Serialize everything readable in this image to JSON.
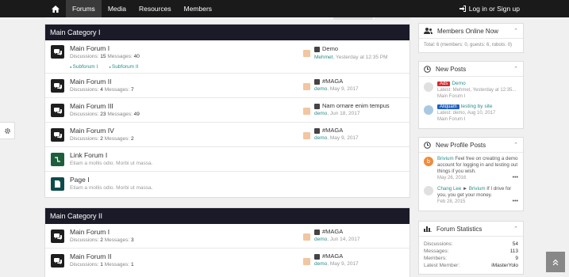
{
  "nav": {
    "items": [
      "Forums",
      "Media",
      "Resources",
      "Members"
    ],
    "login_label": "Log in or Sign up"
  },
  "categories": [
    {
      "title": "Main Category I",
      "forums": [
        {
          "title": "Main Forum I",
          "stats": {
            "disc_label": "Discussions:",
            "disc": "15",
            "msg_label": "Messages:",
            "msg": "40"
          },
          "subforums": [
            "Subforum I",
            "Subforum II"
          ],
          "last": {
            "title": "Demo",
            "user": "Mehmet",
            "date": "Yesterday at 12:35 PM"
          }
        },
        {
          "title": "Main Forum II",
          "stats": {
            "disc_label": "Discussions:",
            "disc": "4",
            "msg_label": "Messages:",
            "msg": "7"
          },
          "last": {
            "title": "#MAGA",
            "user": "demo",
            "date": "May 9, 2017"
          }
        },
        {
          "title": "Main Forum III",
          "stats": {
            "disc_label": "Discussions:",
            "disc": "23",
            "msg_label": "Messages:",
            "msg": "49"
          },
          "last": {
            "title": "Nam ornare enim tempus",
            "user": "demo",
            "date": "Jun 18, 2017"
          }
        },
        {
          "title": "Main Forum IV",
          "stats": {
            "disc_label": "Discussions:",
            "disc": "2",
            "msg_label": "Messages:",
            "msg": "2"
          },
          "last": {
            "title": "#MAGA",
            "user": "demo",
            "date": "May 9, 2017"
          }
        },
        {
          "title": "Link Forum I",
          "desc": "Etiam a mollis odio. Morbi ut massa."
        },
        {
          "title": "Page I",
          "desc": "Etiam a mollis odio. Morbi ut massa."
        }
      ]
    },
    {
      "title": "Main Category II",
      "forums": [
        {
          "title": "Main Forum I",
          "stats": {
            "disc_label": "Discussions:",
            "disc": "2",
            "msg_label": "Messages:",
            "msg": "3"
          },
          "last": {
            "title": "#MAGA",
            "user": "demo",
            "date": "Jun 14, 2017"
          }
        },
        {
          "title": "Main Forum II",
          "stats": {
            "disc_label": "Discussions:",
            "disc": "1",
            "msg_label": "Messages:",
            "msg": "1"
          },
          "last": {
            "title": "#MAGA",
            "user": "demo",
            "date": "May 9, 2017"
          }
        }
      ]
    }
  ],
  "sidebar": {
    "online": {
      "title": "Members Online Now",
      "text": "Total: 6 (members: 0, guests: 6, robots: 0)"
    },
    "new_posts": {
      "title": "New Posts",
      "items": [
        {
          "badge": "Ads",
          "badge_color": "#d9282f",
          "title": "Demo",
          "latest": "Latest: Mehmet, Yesterday at 12:35...",
          "forum": "Main Forum I"
        },
        {
          "badge": "Aliquam",
          "badge_color": "#1f5fc4",
          "title": "testing by site",
          "latest": "Latest: demo, Aug 10, 2017",
          "forum": "Main Forum I"
        }
      ]
    },
    "profile_posts": {
      "title": "New Profile Posts",
      "items": [
        {
          "user": "Brivium",
          "text": "Feel free on creating a demo account for logging in and testing out things if you wish.",
          "date": "May 26, 2016"
        },
        {
          "user": "Chang Lee",
          "arrow": "►",
          "target": "Brivium",
          "text": "If I drive for you, you get your money.",
          "date": "Feb 28, 2015"
        }
      ]
    },
    "stats": {
      "title": "Forum Statistics",
      "rows": [
        {
          "label": "Discussions:",
          "value": "54"
        },
        {
          "label": "Messages:",
          "value": "113"
        },
        {
          "label": "Members:",
          "value": "9"
        },
        {
          "label": "Latest Member:",
          "value": "iMasterYolo"
        }
      ]
    }
  }
}
